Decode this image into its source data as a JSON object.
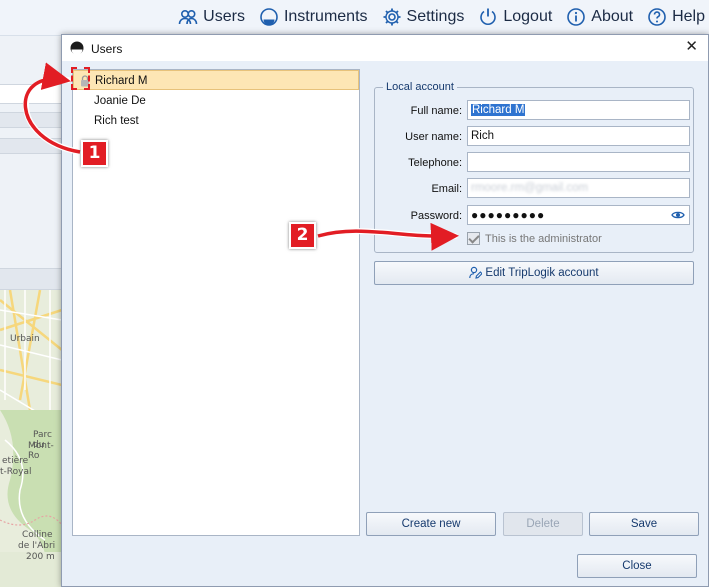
{
  "topnav": {
    "items": [
      {
        "label": "Users",
        "icon": "users-icon"
      },
      {
        "label": "Instruments",
        "icon": "instrument-icon"
      },
      {
        "label": "Settings",
        "icon": "gear-icon"
      },
      {
        "label": "Logout",
        "icon": "power-icon"
      },
      {
        "label": "About",
        "icon": "info-icon"
      },
      {
        "label": "Help",
        "icon": "help-icon"
      }
    ]
  },
  "map": {
    "labels": [
      "Urbain",
      "Parc du",
      "Mont-Ro",
      "etière",
      "t-Royal",
      "Colline",
      "de l'Abri",
      "200 m"
    ]
  },
  "dialog": {
    "title": "Users",
    "close_glyph": "✕",
    "users": [
      {
        "name": "Richard M",
        "selected": true,
        "locked": true
      },
      {
        "name": "Joanie De",
        "selected": false,
        "locked": false
      },
      {
        "name": "Rich test",
        "selected": false,
        "locked": false
      }
    ],
    "local_account": {
      "legend": "Local account",
      "full_name_label": "Full name:",
      "full_name_value": "Richard M",
      "user_name_label": "User name:",
      "user_name_value": "Rich",
      "telephone_label": "Telephone:",
      "telephone_value": "",
      "email_label": "Email:",
      "email_value": "rmoore.rm@gmail.com",
      "password_label": "Password:",
      "password_value": "●●●●●●●●●",
      "admin_checkbox_label": "This is the administrator",
      "admin_checked": true
    },
    "edit_account_button": "Edit TripLogik account",
    "buttons": {
      "create_new": "Create new",
      "delete": "Delete",
      "save": "Save",
      "close": "Close"
    }
  },
  "annotations": {
    "badge_1": "1",
    "badge_2": "2",
    "color": "#e21d24"
  }
}
